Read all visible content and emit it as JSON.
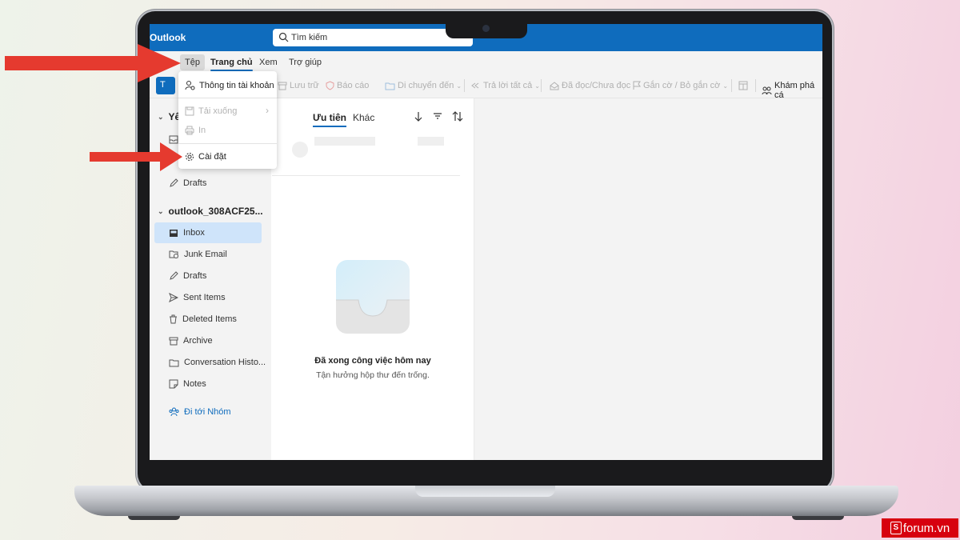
{
  "app": {
    "title": "Outlook"
  },
  "search": {
    "placeholder": "Tìm kiếm"
  },
  "menu": {
    "file": "Tệp",
    "home": "Trang chủ",
    "view": "Xem",
    "help": "Trợ giúp"
  },
  "toolbar": {
    "new_partial": "T",
    "archive": "Lưu trữ",
    "report": "Báo cáo",
    "move_to": "Di chuyển đến",
    "reply_all": "Trả lời tất cả",
    "read_unread": "Đã đọc/Chưa đọc",
    "flag": "Gắn cờ / Bỏ gắn cờ",
    "discover": "Khám phá cá"
  },
  "file_menu": {
    "account_info": "Thông tin tài khoản",
    "download": "Tải xuống",
    "print": "In",
    "settings": "Cài đặt"
  },
  "left_pane": {
    "favorites_partial": "Yê",
    "favorites_drafts": "Drafts",
    "account_name": "outlook_308ACF25...",
    "folders": [
      {
        "label": "Inbox",
        "icon": "inbox-icon"
      },
      {
        "label": "Junk Email",
        "icon": "junk-icon"
      },
      {
        "label": "Drafts",
        "icon": "drafts-icon"
      },
      {
        "label": "Sent Items",
        "icon": "send-icon"
      },
      {
        "label": "Deleted Items",
        "icon": "trash-icon"
      },
      {
        "label": "Archive",
        "icon": "archive-icon"
      },
      {
        "label": "Conversation Histo...",
        "icon": "folder-icon"
      },
      {
        "label": "Notes",
        "icon": "notes-icon"
      }
    ],
    "go_to_groups": "Đi tới Nhóm"
  },
  "message_list": {
    "tab_focused": "Ưu tiên",
    "tab_other": "Khác",
    "empty_title": "Đã xong công việc hôm nay",
    "empty_subtitle": "Tận hưởng hộp thư đến trống."
  },
  "watermark": {
    "text": "forum.vn",
    "logo_letter": "S"
  },
  "colors": {
    "brand_blue": "#0f6cbd",
    "arrow_red": "#e53a2f",
    "selected_folder": "#cfe4fa",
    "watermark_red": "#d7000f"
  }
}
